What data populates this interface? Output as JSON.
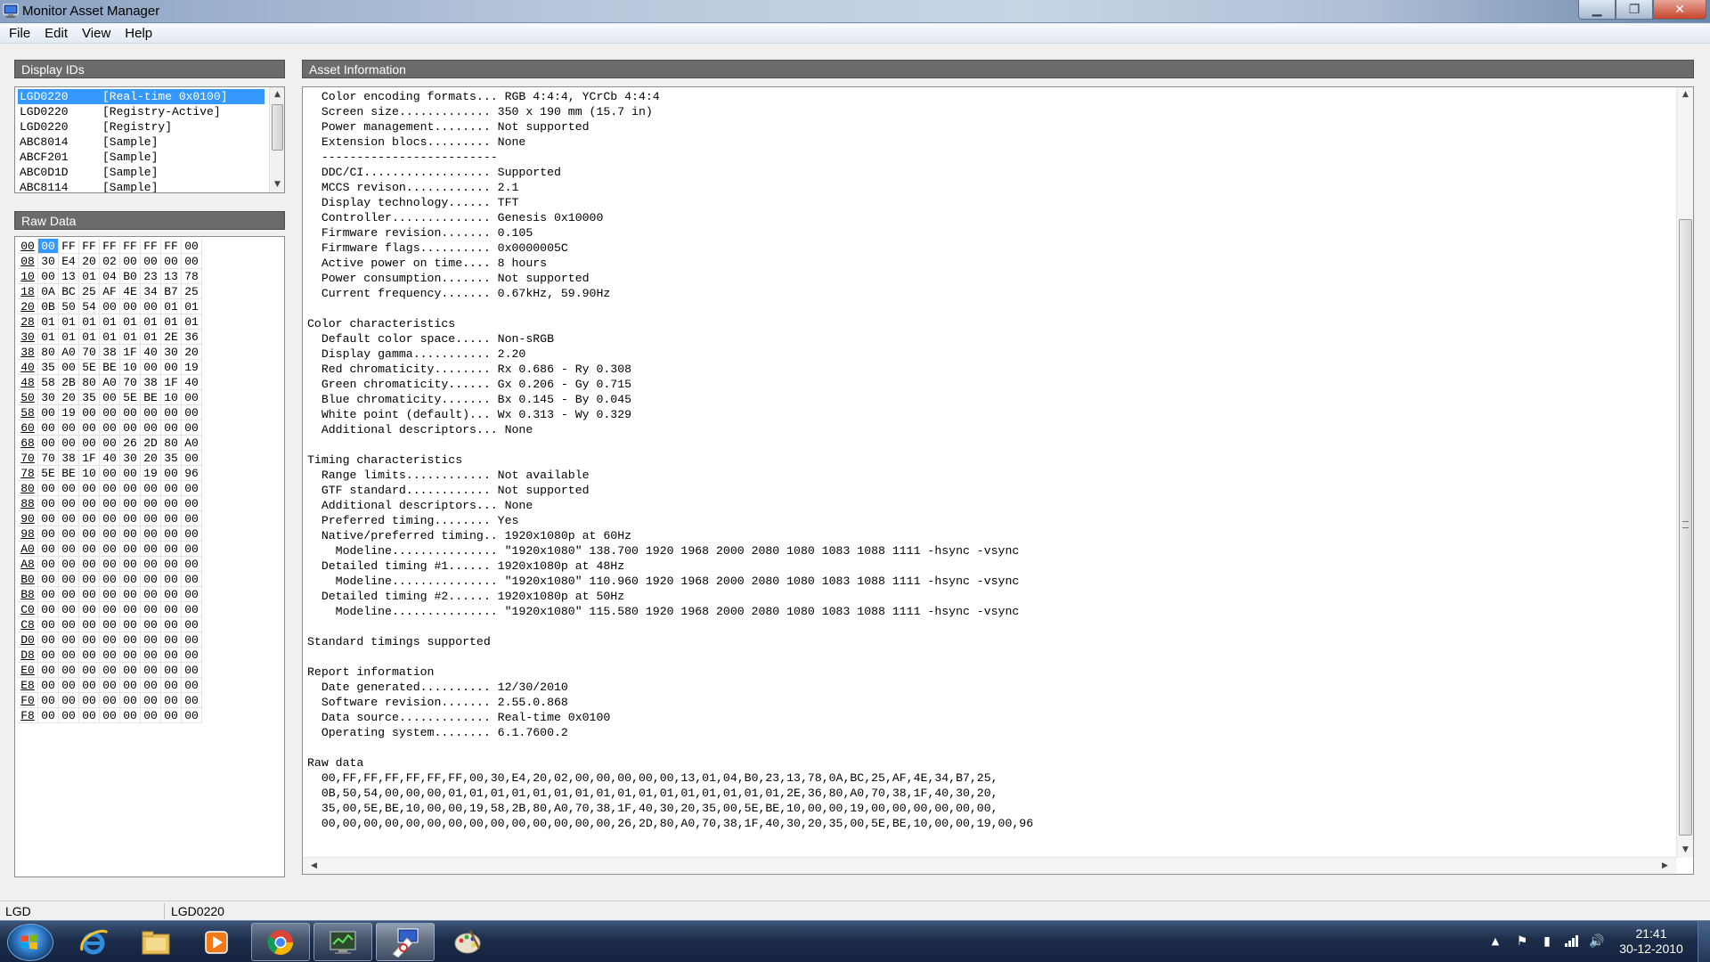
{
  "window": {
    "title": "Monitor Asset Manager",
    "buttons": {
      "minimize": "▁",
      "maximize": "❐",
      "close": "✕"
    }
  },
  "menu": [
    "File",
    "Edit",
    "View",
    "Help"
  ],
  "display_ids": {
    "header": "Display IDs",
    "items": [
      {
        "code": "LGD0220",
        "tag": "[Real-time 0x0100]",
        "selected": true
      },
      {
        "code": "LGD0220",
        "tag": "[Registry-Active]",
        "selected": false
      },
      {
        "code": "LGD0220",
        "tag": "[Registry]",
        "selected": false
      },
      {
        "code": "ABC8014",
        "tag": "[Sample]",
        "selected": false
      },
      {
        "code": "ABCF201",
        "tag": "[Sample]",
        "selected": false
      },
      {
        "code": "ABC0D1D",
        "tag": "[Sample]",
        "selected": false
      },
      {
        "code": "ABC8114",
        "tag": "[Sample]",
        "selected": false
      }
    ]
  },
  "raw_data": {
    "header": "Raw Data",
    "rows": [
      [
        "00",
        "00",
        "FF",
        "FF",
        "FF",
        "FF",
        "FF",
        "FF",
        "00"
      ],
      [
        "08",
        "30",
        "E4",
        "20",
        "02",
        "00",
        "00",
        "00",
        "00"
      ],
      [
        "10",
        "00",
        "13",
        "01",
        "04",
        "B0",
        "23",
        "13",
        "78"
      ],
      [
        "18",
        "0A",
        "BC",
        "25",
        "AF",
        "4E",
        "34",
        "B7",
        "25"
      ],
      [
        "20",
        "0B",
        "50",
        "54",
        "00",
        "00",
        "00",
        "01",
        "01"
      ],
      [
        "28",
        "01",
        "01",
        "01",
        "01",
        "01",
        "01",
        "01",
        "01"
      ],
      [
        "30",
        "01",
        "01",
        "01",
        "01",
        "01",
        "01",
        "2E",
        "36"
      ],
      [
        "38",
        "80",
        "A0",
        "70",
        "38",
        "1F",
        "40",
        "30",
        "20"
      ],
      [
        "40",
        "35",
        "00",
        "5E",
        "BE",
        "10",
        "00",
        "00",
        "19"
      ],
      [
        "48",
        "58",
        "2B",
        "80",
        "A0",
        "70",
        "38",
        "1F",
        "40"
      ],
      [
        "50",
        "30",
        "20",
        "35",
        "00",
        "5E",
        "BE",
        "10",
        "00"
      ],
      [
        "58",
        "00",
        "19",
        "00",
        "00",
        "00",
        "00",
        "00",
        "00"
      ],
      [
        "60",
        "00",
        "00",
        "00",
        "00",
        "00",
        "00",
        "00",
        "00"
      ],
      [
        "68",
        "00",
        "00",
        "00",
        "00",
        "26",
        "2D",
        "80",
        "A0"
      ],
      [
        "70",
        "70",
        "38",
        "1F",
        "40",
        "30",
        "20",
        "35",
        "00"
      ],
      [
        "78",
        "5E",
        "BE",
        "10",
        "00",
        "00",
        "19",
        "00",
        "96"
      ],
      [
        "80",
        "00",
        "00",
        "00",
        "00",
        "00",
        "00",
        "00",
        "00"
      ],
      [
        "88",
        "00",
        "00",
        "00",
        "00",
        "00",
        "00",
        "00",
        "00"
      ],
      [
        "90",
        "00",
        "00",
        "00",
        "00",
        "00",
        "00",
        "00",
        "00"
      ],
      [
        "98",
        "00",
        "00",
        "00",
        "00",
        "00",
        "00",
        "00",
        "00"
      ],
      [
        "A0",
        "00",
        "00",
        "00",
        "00",
        "00",
        "00",
        "00",
        "00"
      ],
      [
        "A8",
        "00",
        "00",
        "00",
        "00",
        "00",
        "00",
        "00",
        "00"
      ],
      [
        "B0",
        "00",
        "00",
        "00",
        "00",
        "00",
        "00",
        "00",
        "00"
      ],
      [
        "B8",
        "00",
        "00",
        "00",
        "00",
        "00",
        "00",
        "00",
        "00"
      ],
      [
        "C0",
        "00",
        "00",
        "00",
        "00",
        "00",
        "00",
        "00",
        "00"
      ],
      [
        "C8",
        "00",
        "00",
        "00",
        "00",
        "00",
        "00",
        "00",
        "00"
      ],
      [
        "D0",
        "00",
        "00",
        "00",
        "00",
        "00",
        "00",
        "00",
        "00"
      ],
      [
        "D8",
        "00",
        "00",
        "00",
        "00",
        "00",
        "00",
        "00",
        "00"
      ],
      [
        "E0",
        "00",
        "00",
        "00",
        "00",
        "00",
        "00",
        "00",
        "00"
      ],
      [
        "E8",
        "00",
        "00",
        "00",
        "00",
        "00",
        "00",
        "00",
        "00"
      ],
      [
        "F0",
        "00",
        "00",
        "00",
        "00",
        "00",
        "00",
        "00",
        "00"
      ],
      [
        "F8",
        "00",
        "00",
        "00",
        "00",
        "00",
        "00",
        "00",
        "00"
      ]
    ]
  },
  "asset_info": {
    "header": "Asset Information",
    "lines": [
      "  Color encoding formats... RGB 4:4:4, YCrCb 4:4:4",
      "  Screen size............. 350 x 190 mm (15.7 in)",
      "  Power management........ Not supported",
      "  Extension blocs......... None",
      "  -------------------------",
      "  DDC/CI.................. Supported",
      "  MCCS revison............ 2.1",
      "  Display technology...... TFT",
      "  Controller.............. Genesis 0x10000",
      "  Firmware revision....... 0.105",
      "  Firmware flags.......... 0x0000005C",
      "  Active power on time.... 8 hours",
      "  Power consumption....... Not supported",
      "  Current frequency....... 0.67kHz, 59.90Hz",
      "",
      "Color characteristics",
      "  Default color space..... Non-sRGB",
      "  Display gamma........... 2.20",
      "  Red chromaticity........ Rx 0.686 - Ry 0.308",
      "  Green chromaticity...... Gx 0.206 - Gy 0.715",
      "  Blue chromaticity....... Bx 0.145 - By 0.045",
      "  White point (default)... Wx 0.313 - Wy 0.329",
      "  Additional descriptors... None",
      "",
      "Timing characteristics",
      "  Range limits............ Not available",
      "  GTF standard............ Not supported",
      "  Additional descriptors... None",
      "  Preferred timing........ Yes",
      "  Native/preferred timing.. 1920x1080p at 60Hz",
      "    Modeline............... \"1920x1080\" 138.700 1920 1968 2000 2080 1080 1083 1088 1111 -hsync -vsync",
      "  Detailed timing #1...... 1920x1080p at 48Hz",
      "    Modeline............... \"1920x1080\" 110.960 1920 1968 2000 2080 1080 1083 1088 1111 -hsync -vsync",
      "  Detailed timing #2...... 1920x1080p at 50Hz",
      "    Modeline............... \"1920x1080\" 115.580 1920 1968 2000 2080 1080 1083 1088 1111 -hsync -vsync",
      "",
      "Standard timings supported",
      "",
      "Report information",
      "  Date generated.......... 12/30/2010",
      "  Software revision....... 2.55.0.868",
      "  Data source............. Real-time 0x0100",
      "  Operating system........ 6.1.7600.2",
      "",
      "Raw data",
      "  00,FF,FF,FF,FF,FF,FF,00,30,E4,20,02,00,00,00,00,00,13,01,04,B0,23,13,78,0A,BC,25,AF,4E,34,B7,25,",
      "  0B,50,54,00,00,00,01,01,01,01,01,01,01,01,01,01,01,01,01,01,01,01,2E,36,80,A0,70,38,1F,40,30,20,",
      "  35,00,5E,BE,10,00,00,19,58,2B,80,A0,70,38,1F,40,30,20,35,00,5E,BE,10,00,00,19,00,00,00,00,00,00,",
      "  00,00,00,00,00,00,00,00,00,00,00,00,00,00,26,2D,80,A0,70,38,1F,40,30,20,35,00,5E,BE,10,00,00,19,00,96"
    ]
  },
  "status": {
    "left": "LGD",
    "right": "LGD0220"
  },
  "taskbar": {
    "apps": [
      "internet-explorer",
      "windows-explorer",
      "media-player",
      "chrome",
      "system-monitor",
      "monitor-asset-manager",
      "paint"
    ],
    "clock_time": "21:41",
    "clock_date": "30-12-2010"
  }
}
